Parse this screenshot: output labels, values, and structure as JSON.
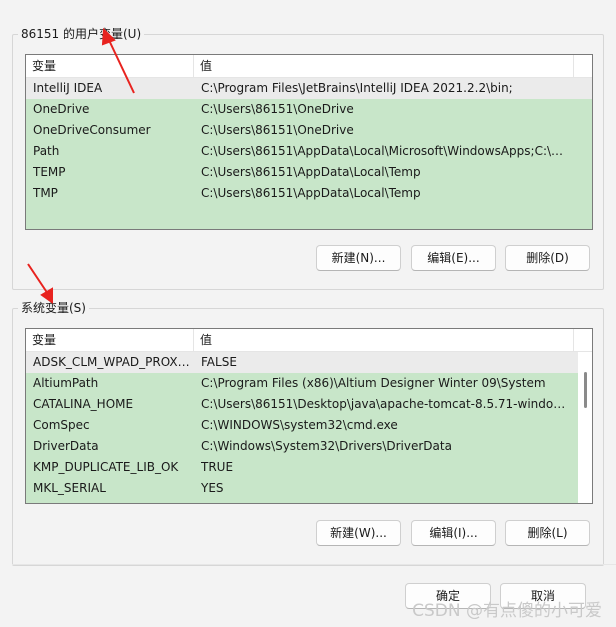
{
  "user_vars": {
    "title": "86151 的用户变量(U)",
    "columns": [
      "变量",
      "值"
    ],
    "rows": [
      {
        "name": "IntelliJ IDEA",
        "value": "C:\\Program Files\\JetBrains\\IntelliJ IDEA 2021.2.2\\bin;"
      },
      {
        "name": "OneDrive",
        "value": "C:\\Users\\86151\\OneDrive"
      },
      {
        "name": "OneDriveConsumer",
        "value": "C:\\Users\\86151\\OneDrive"
      },
      {
        "name": "Path",
        "value": "C:\\Users\\86151\\AppData\\Local\\Microsoft\\WindowsApps;C:\\U..."
      },
      {
        "name": "TEMP",
        "value": "C:\\Users\\86151\\AppData\\Local\\Temp"
      },
      {
        "name": "TMP",
        "value": "C:\\Users\\86151\\AppData\\Local\\Temp"
      }
    ],
    "new_button": "新建(N)...",
    "edit_button": "编辑(E)...",
    "delete_button": "删除(D)"
  },
  "system_vars": {
    "title": "系统变量(S)",
    "columns": [
      "变量",
      "值"
    ],
    "rows": [
      {
        "name": "ADSK_CLM_WPAD_PROXY...",
        "value": "FALSE"
      },
      {
        "name": "AltiumPath",
        "value": "C:\\Program Files (x86)\\Altium Designer Winter 09\\System"
      },
      {
        "name": "CATALINA_HOME",
        "value": "C:\\Users\\86151\\Desktop\\java\\apache-tomcat-8.5.71-windows..."
      },
      {
        "name": "ComSpec",
        "value": "C:\\WINDOWS\\system32\\cmd.exe"
      },
      {
        "name": "DriverData",
        "value": "C:\\Windows\\System32\\Drivers\\DriverData"
      },
      {
        "name": "KMP_DUPLICATE_LIB_OK",
        "value": "TRUE"
      },
      {
        "name": "MKL_SERIAL",
        "value": "YES"
      }
    ],
    "new_button": "新建(W)...",
    "edit_button": "编辑(I)...",
    "delete_button": "删除(L)"
  },
  "footer": {
    "ok_button": "确定",
    "cancel_button": "取消"
  },
  "watermark": "CSDN @有点傻的小可爱",
  "colors": {
    "list_highlight": "#c8e6c9",
    "annotation_arrow": "#e8231f"
  }
}
